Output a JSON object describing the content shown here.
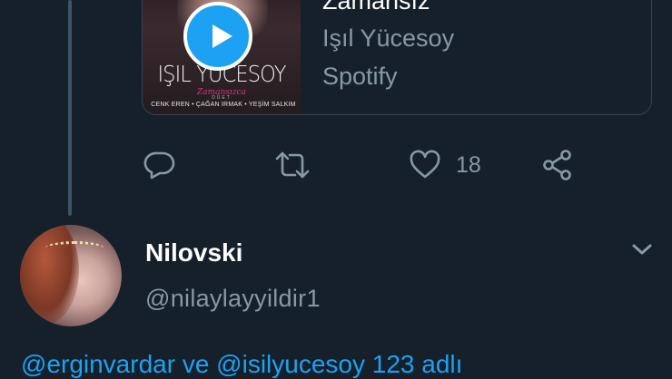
{
  "media_card": {
    "title": "Zamansız",
    "artist": "Işıl Yücesoy",
    "source": "Spotify",
    "album_artist_text": "IŞIL YÜCESOY",
    "album_script_text": "Zamansızca",
    "album_sub_text": "DÜET",
    "album_credits": "CENK EREN • ÇAĞAN IRMAK • YEŞİM SALKIM"
  },
  "actions": {
    "reply_icon": "reply-icon",
    "retweet_icon": "retweet-icon",
    "like_icon": "heart-icon",
    "like_count": "18",
    "share_icon": "share-icon"
  },
  "reply_tweet": {
    "display_name": "Nilovski",
    "handle": "@nilaylayyildir1",
    "text": "@erginvardar ve @isilyucesoy  123 adlı"
  },
  "colors": {
    "background": "#15202b",
    "accent": "#1da1f2",
    "secondary_text": "#8899a6",
    "border": "#38444d"
  }
}
